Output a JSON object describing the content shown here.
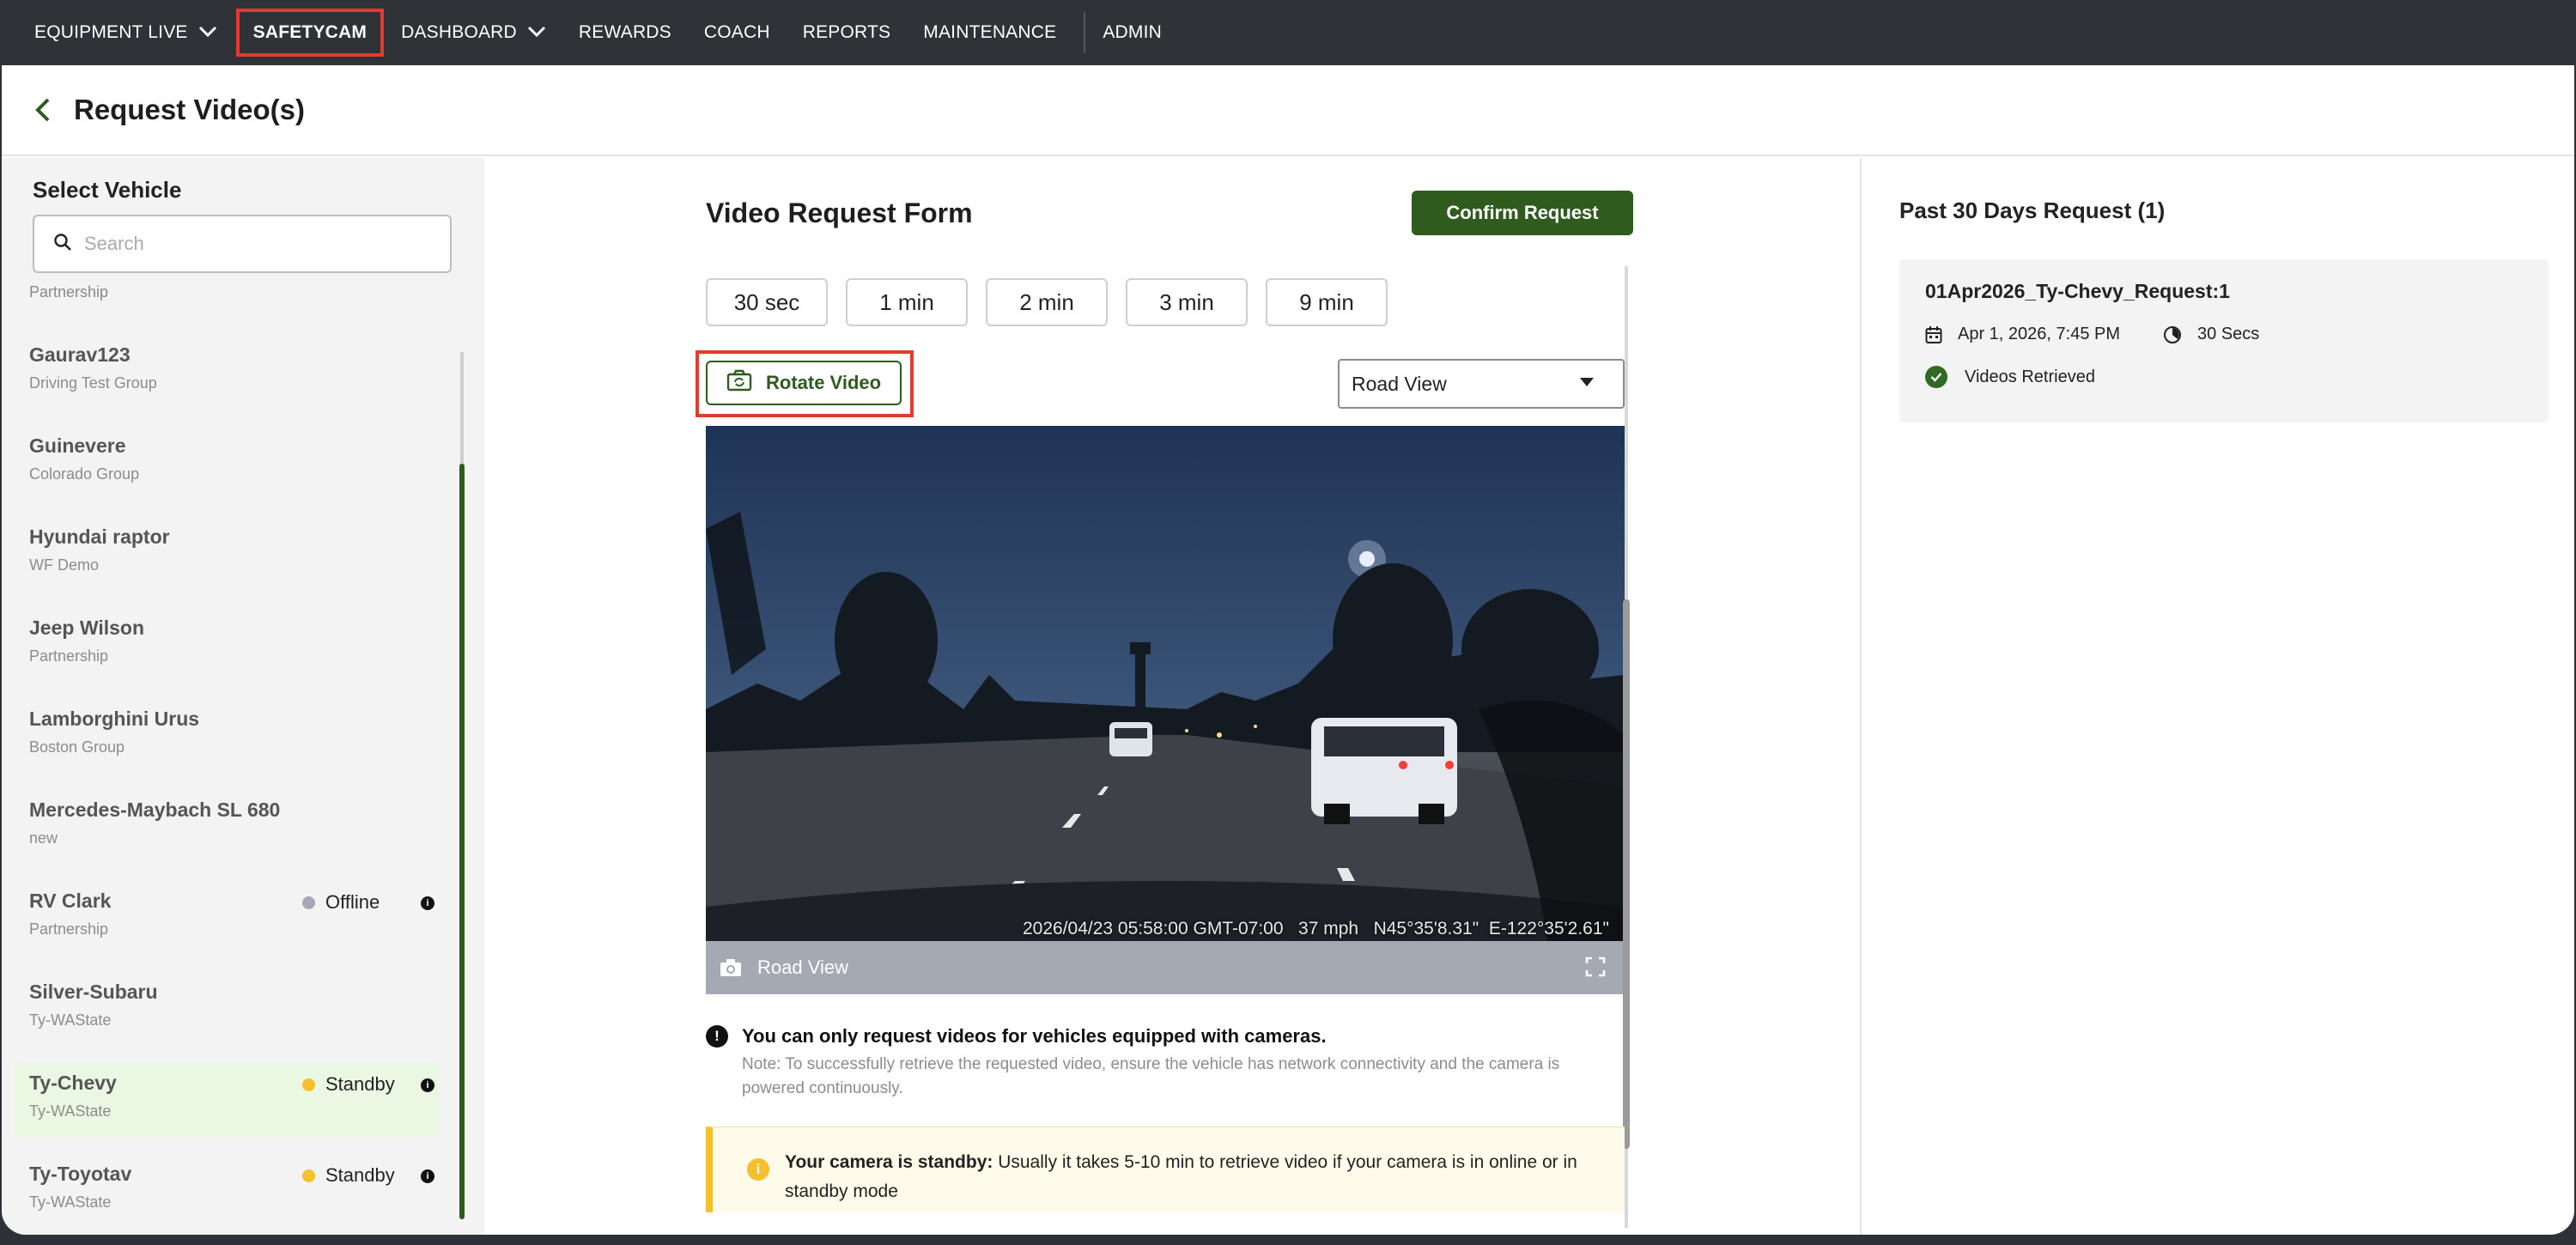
{
  "nav": {
    "items": [
      {
        "label": "EQUIPMENT LIVE",
        "has_dropdown": true
      },
      {
        "label": "SAFETYCAM",
        "active": true
      },
      {
        "label": "DASHBOARD",
        "has_dropdown": true
      },
      {
        "label": "REWARDS"
      },
      {
        "label": "COACH"
      },
      {
        "label": "REPORTS"
      },
      {
        "label": "MAINTENANCE"
      },
      {
        "label": "ADMIN"
      }
    ],
    "highlight_color": "#e53b2e"
  },
  "header": {
    "back_icon": "chevron-left-icon",
    "title": "Request Video(s)"
  },
  "sidebar": {
    "title": "Select Vehicle",
    "search": {
      "placeholder": "Search",
      "value": "",
      "icon": "search-icon"
    },
    "partial_group_above": "Partnership",
    "vehicles": [
      {
        "name": "Gaurav123",
        "group": "Driving Test Group",
        "status": null
      },
      {
        "name": "Guinevere",
        "group": "Colorado Group",
        "status": null
      },
      {
        "name": "Hyundai raptor",
        "group": "WF Demo",
        "status": null
      },
      {
        "name": "Jeep Wilson",
        "group": "Partnership",
        "status": null
      },
      {
        "name": "Lamborghini Urus",
        "group": "Boston Group",
        "status": null
      },
      {
        "name": "Mercedes-Maybach SL 680",
        "group": "new",
        "status": null
      },
      {
        "name": "RV Clark",
        "group": "Partnership",
        "status": "Offline",
        "status_color": "#a6a6b8"
      },
      {
        "name": "Silver-Subaru",
        "group": "Ty-WAState",
        "status": null
      },
      {
        "name": "Ty-Chevy",
        "group": "Ty-WAState",
        "status": "Standby",
        "status_color": "#f5c02c",
        "selected": true
      },
      {
        "name": "Ty-Toyotav",
        "group": "Ty-WAState",
        "status": "Standby",
        "status_color": "#f5c02c"
      }
    ]
  },
  "form": {
    "title": "Video Request Form",
    "confirm_label": "Confirm Request",
    "durations": [
      "30 sec",
      "1 min",
      "2 min",
      "3 min",
      "9 min"
    ],
    "rotate_label": "Rotate Video",
    "view_select": {
      "value": "Road View"
    },
    "video": {
      "overlay": "2026/04/23 05:58:00 GMT-07:00   37 mph   N45°35'8.31\"  E-122°35'2.61\"",
      "label": "Road View"
    },
    "notice": {
      "heading": "You can only request videos for vehicles equipped with cameras.",
      "note": "Note: To successfully retrieve the requested video, ensure the vehicle has network connectivity and the camera is powered continuously."
    },
    "standby_alert": {
      "bold": "Your camera is standby:",
      "text": " Usually it takes 5-10 min to retrieve video if your camera is in online or in standby mode"
    },
    "accent_color": "#2f5b1e"
  },
  "past_requests": {
    "title": "Past 30 Days Request (1)",
    "items": [
      {
        "name": "01Apr2026_Ty-Chevy_Request:1",
        "date": "Apr 1, 2026, 7:45 PM",
        "duration": "30 Secs",
        "status": "Videos Retrieved"
      }
    ]
  }
}
